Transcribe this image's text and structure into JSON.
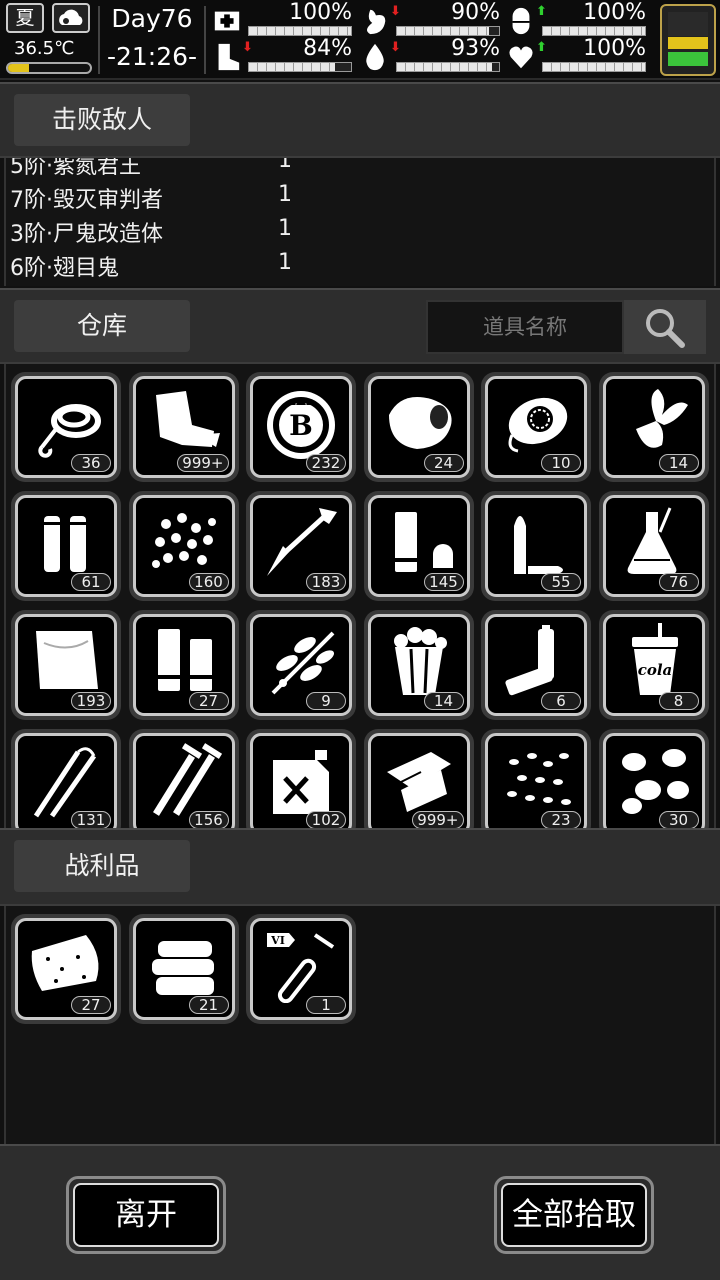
{
  "status": {
    "season": "夏",
    "temperature": "36.5℃",
    "temperature_level": 0.25,
    "day": "Day76",
    "time": "-21:26-",
    "stats": [
      {
        "icon": "medkit-icon",
        "value": "100%",
        "level": 1.0,
        "trend": "none"
      },
      {
        "icon": "stomach-icon",
        "value": "90%",
        "level": 0.9,
        "trend": "down"
      },
      {
        "icon": "pill-icon",
        "value": "100%",
        "level": 1.0,
        "trend": "up"
      },
      {
        "icon": "boot-icon",
        "value": "84%",
        "level": 0.84,
        "trend": "down"
      },
      {
        "icon": "water-drop-icon",
        "value": "93%",
        "level": 0.93,
        "trend": "down"
      },
      {
        "icon": "heart-icon",
        "value": "100%",
        "level": 1.0,
        "trend": "up"
      }
    ],
    "colors": {
      "temperature": "#e3c31b",
      "battery_yellow": "#e3c31b",
      "battery_green": "#3bc43b",
      "trend_down": "#e12020",
      "trend_up": "#2fd12f"
    }
  },
  "defeated": {
    "title": "击败敌人",
    "rows": [
      {
        "name": "5阶·紫氮君王",
        "count": "1"
      },
      {
        "name": "7阶·毁灭审判者",
        "count": "1"
      },
      {
        "name": "3阶·尸鬼改造体",
        "count": "1"
      },
      {
        "name": "6阶·翅目鬼",
        "count": "1"
      }
    ]
  },
  "warehouse": {
    "title": "仓库",
    "search_placeholder": "道具名称",
    "items": [
      {
        "icon": "rope-icon",
        "qty": "36"
      },
      {
        "icon": "cloth-rags-icon",
        "qty": "999+"
      },
      {
        "icon": "bitcoin-token-icon",
        "qty": "232"
      },
      {
        "icon": "meat-chunk-icon",
        "qty": "24"
      },
      {
        "icon": "turbine-part-icon",
        "qty": "10"
      },
      {
        "icon": "vegetable-icon",
        "qty": "14"
      },
      {
        "icon": "rifle-ammo-icon",
        "qty": "61"
      },
      {
        "icon": "pellets-icon",
        "qty": "160"
      },
      {
        "icon": "arrow-icon",
        "qty": "183"
      },
      {
        "icon": "shotgun-shell-icon",
        "qty": "145"
      },
      {
        "icon": "bullet-icon",
        "qty": "55"
      },
      {
        "icon": "flask-icon",
        "qty": "76"
      },
      {
        "icon": "fabric-icon",
        "qty": "193"
      },
      {
        "icon": "shells-pair-icon",
        "qty": "27"
      },
      {
        "icon": "herb-branch-icon",
        "qty": "9"
      },
      {
        "icon": "popcorn-icon",
        "qty": "14"
      },
      {
        "icon": "batteries-icon",
        "qty": "6"
      },
      {
        "icon": "cola-cup-icon",
        "qty": "8",
        "label": "cola"
      },
      {
        "icon": "tweezers-icon",
        "qty": "131"
      },
      {
        "icon": "screws-icon",
        "qty": "156"
      },
      {
        "icon": "fuel-can-icon",
        "qty": "102"
      },
      {
        "icon": "paper-sheets-icon",
        "qty": "999+"
      },
      {
        "icon": "seeds-icon",
        "qty": "23"
      },
      {
        "icon": "nuts-icon",
        "qty": "30"
      }
    ]
  },
  "loot": {
    "title": "战利品",
    "items": [
      {
        "icon": "raw-meat-icon",
        "qty": "27"
      },
      {
        "icon": "folded-cloth-icon",
        "qty": "21"
      },
      {
        "icon": "test-tube-icon",
        "qty": "1",
        "label": "VI"
      }
    ]
  },
  "buttons": {
    "leave": "离开",
    "take_all": "全部拾取"
  }
}
